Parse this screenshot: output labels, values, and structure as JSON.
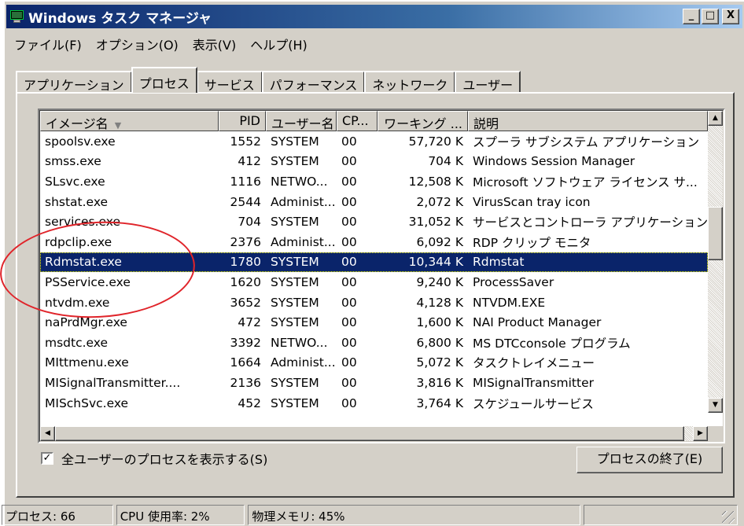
{
  "window": {
    "title": "Windows タスク マネージャ",
    "controls": {
      "minimize": "_",
      "maximize": "□",
      "close": "X"
    }
  },
  "menu": [
    "ファイル(F)",
    "オプション(O)",
    "表示(V)",
    "ヘルプ(H)"
  ],
  "tabs": [
    {
      "label": "アプリケーション",
      "active": false
    },
    {
      "label": "プロセス",
      "active": true
    },
    {
      "label": "サービス",
      "active": false
    },
    {
      "label": "パフォーマンス",
      "active": false
    },
    {
      "label": "ネットワーク",
      "active": false
    },
    {
      "label": "ユーザー",
      "active": false
    }
  ],
  "process_table": {
    "columns": {
      "name": "イメージ名",
      "pid": "PID",
      "user": "ユーザー名",
      "cpu": "CP...",
      "mem": "ワーキング ...",
      "desc": "説明"
    },
    "sort_indicator": "▼",
    "rows": [
      {
        "name": "spoolsv.exe",
        "pid": "1552",
        "user": "SYSTEM",
        "cpu": "00",
        "mem": "57,720 K",
        "desc": "スプーラ サブシステム アプリケーション",
        "selected": false
      },
      {
        "name": "smss.exe",
        "pid": "412",
        "user": "SYSTEM",
        "cpu": "00",
        "mem": "704 K",
        "desc": "Windows Session Manager",
        "selected": false
      },
      {
        "name": "SLsvc.exe",
        "pid": "1116",
        "user": "NETWO...",
        "cpu": "00",
        "mem": "12,508 K",
        "desc": "Microsoft ソフトウェア ライセンス サ...",
        "selected": false
      },
      {
        "name": "shstat.exe",
        "pid": "2544",
        "user": "Administ...",
        "cpu": "00",
        "mem": "2,072 K",
        "desc": "VirusScan tray icon",
        "selected": false
      },
      {
        "name": "services.exe",
        "pid": "704",
        "user": "SYSTEM",
        "cpu": "00",
        "mem": "31,052 K",
        "desc": "サービスとコントローラ アプリケーション",
        "selected": false
      },
      {
        "name": "rdpclip.exe",
        "pid": "2376",
        "user": "Administ...",
        "cpu": "00",
        "mem": "6,092 K",
        "desc": "RDP クリップ モニタ",
        "selected": false
      },
      {
        "name": "Rdmstat.exe",
        "pid": "1780",
        "user": "SYSTEM",
        "cpu": "00",
        "mem": "10,344 K",
        "desc": "Rdmstat",
        "selected": true
      },
      {
        "name": "PSService.exe",
        "pid": "1620",
        "user": "SYSTEM",
        "cpu": "00",
        "mem": "9,240 K",
        "desc": "ProcessSaver",
        "selected": false
      },
      {
        "name": "ntvdm.exe",
        "pid": "3652",
        "user": "SYSTEM",
        "cpu": "00",
        "mem": "4,128 K",
        "desc": "NTVDM.EXE",
        "selected": false
      },
      {
        "name": "naPrdMgr.exe",
        "pid": "472",
        "user": "SYSTEM",
        "cpu": "00",
        "mem": "1,600 K",
        "desc": "NAI Product Manager",
        "selected": false
      },
      {
        "name": "msdtc.exe",
        "pid": "3392",
        "user": "NETWO...",
        "cpu": "00",
        "mem": "6,800 K",
        "desc": "MS DTCconsole プログラム",
        "selected": false
      },
      {
        "name": "MIttmenu.exe",
        "pid": "1664",
        "user": "Administ...",
        "cpu": "00",
        "mem": "5,072 K",
        "desc": "タスクトレイメニュー",
        "selected": false
      },
      {
        "name": "MISignalTransmitter....",
        "pid": "2136",
        "user": "SYSTEM",
        "cpu": "00",
        "mem": "3,816 K",
        "desc": "MISignalTransmitter",
        "selected": false
      },
      {
        "name": "MISchSvc.exe",
        "pid": "452",
        "user": "SYSTEM",
        "cpu": "00",
        "mem": "3,764 K",
        "desc": "スケジュールサービス",
        "selected": false
      }
    ]
  },
  "scrollbar_icons": {
    "up": "▲",
    "down": "▼",
    "left": "◀",
    "right": "▶"
  },
  "show_all_users": {
    "label": "全ユーザーのプロセスを表示する(S)",
    "checked": true,
    "mark": "✓"
  },
  "end_process_button": "プロセスの終了(E)",
  "statusbar": {
    "processes": "プロセス: 66",
    "cpu": "CPU 使用率: 2%",
    "memory": "物理メモリ: 45%"
  },
  "colors": {
    "titlebar": "#0a246a",
    "selection": "#0a246a",
    "face": "#d4d0c8",
    "annotation": "#e0242a"
  }
}
